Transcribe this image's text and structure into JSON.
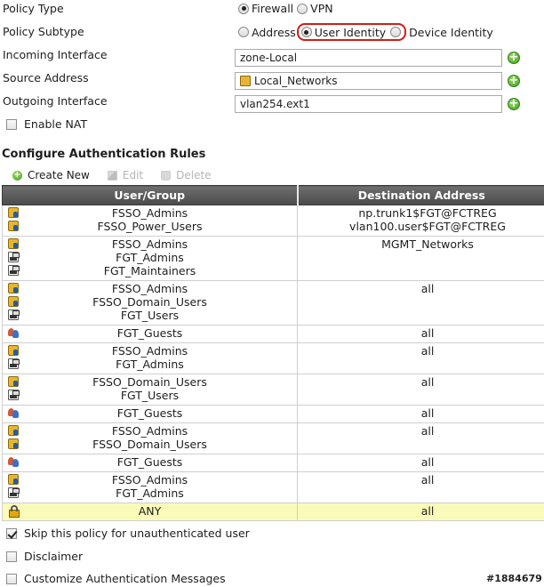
{
  "form": {
    "policy_type": {
      "label": "Policy Type",
      "options": [
        "Firewall",
        "VPN"
      ],
      "selected": "Firewall"
    },
    "policy_subtype": {
      "label": "Policy Subtype",
      "options": [
        "Address",
        "User Identity",
        "Device Identity"
      ],
      "selected": "User Identity"
    },
    "incoming_interface": {
      "label": "Incoming Interface",
      "value": "zone-Local"
    },
    "source_address": {
      "label": "Source Address",
      "value": "Local_Networks"
    },
    "outgoing_interface": {
      "label": "Outgoing Interface",
      "value": "vlan254.ext1"
    },
    "enable_nat": {
      "label": "Enable NAT",
      "checked": false
    }
  },
  "auth_rules": {
    "title": "Configure Authentication Rules",
    "toolbar": {
      "create_new": "Create New",
      "edit": "Edit",
      "delete": "Delete"
    },
    "columns": [
      "User/Group",
      "Destination Address"
    ],
    "rows": [
      {
        "users": [
          {
            "name": "FSSO_Admins",
            "icon": "fsso-icon"
          },
          {
            "name": "FSSO_Power_Users",
            "icon": "fsso-icon"
          }
        ],
        "destinations": [
          "np.trunk1$FGT@FCTREG",
          "vlan100.user$FGT@FCTREG"
        ]
      },
      {
        "users": [
          {
            "name": "FSSO_Admins",
            "icon": "fsso-icon"
          },
          {
            "name": "FGT_Admins",
            "icon": "fgt-icon"
          },
          {
            "name": "FGT_Maintainers",
            "icon": "fgt-icon"
          }
        ],
        "destinations": [
          "MGMT_Networks"
        ]
      },
      {
        "users": [
          {
            "name": "FSSO_Admins",
            "icon": "fsso-icon"
          },
          {
            "name": "FSSO_Domain_Users",
            "icon": "fsso-icon"
          },
          {
            "name": "FGT_Users",
            "icon": "fgt-icon"
          }
        ],
        "destinations": [
          "all"
        ]
      },
      {
        "users": [
          {
            "name": "FGT_Guests",
            "icon": "guest-icon"
          }
        ],
        "destinations": [
          "all"
        ]
      },
      {
        "users": [
          {
            "name": "FSSO_Admins",
            "icon": "fsso-icon"
          },
          {
            "name": "FGT_Admins",
            "icon": "fgt-icon"
          }
        ],
        "destinations": [
          "all"
        ]
      },
      {
        "users": [
          {
            "name": "FSSO_Domain_Users",
            "icon": "fsso-icon"
          },
          {
            "name": "FGT_Users",
            "icon": "fgt-icon"
          }
        ],
        "destinations": [
          "all"
        ]
      },
      {
        "users": [
          {
            "name": "FGT_Guests",
            "icon": "guest-icon"
          }
        ],
        "destinations": [
          "all"
        ]
      },
      {
        "users": [
          {
            "name": "FSSO_Admins",
            "icon": "fsso-icon"
          },
          {
            "name": "FSSO_Domain_Users",
            "icon": "fsso-icon"
          }
        ],
        "destinations": [
          "all"
        ]
      },
      {
        "users": [
          {
            "name": "FGT_Guests",
            "icon": "guest-icon"
          }
        ],
        "destinations": [
          "all"
        ]
      },
      {
        "users": [
          {
            "name": "FSSO_Admins",
            "icon": "fsso-icon"
          },
          {
            "name": "FGT_Admins",
            "icon": "fgt-icon"
          }
        ],
        "destinations": [
          "all"
        ]
      },
      {
        "users": [
          {
            "name": "ANY",
            "icon": "any-icon"
          }
        ],
        "destinations": [
          "all"
        ],
        "highlight": true
      }
    ]
  },
  "options": {
    "skip_unauth": {
      "label": "Skip this policy for unauthenticated user",
      "checked": true
    },
    "disclaimer": {
      "label": "Disclaimer",
      "checked": false
    },
    "customize_messages": {
      "label": "Customize Authentication Messages",
      "checked": false
    }
  },
  "watermark": "#1884679",
  "colors": {
    "header_bg": "#555555",
    "any_row_bg": "#fafbb9",
    "highlight_border": "#d61a1a",
    "add_icon": "#4aa522"
  }
}
